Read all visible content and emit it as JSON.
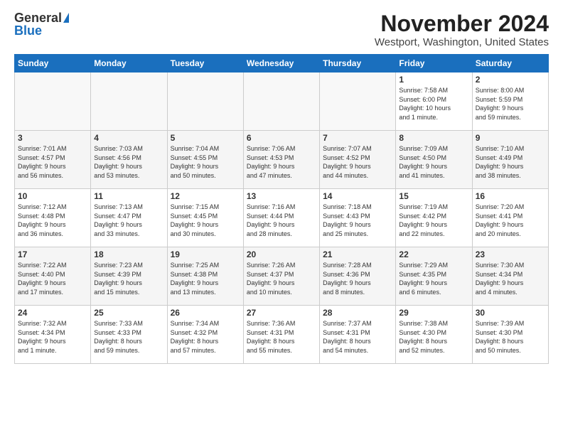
{
  "logo": {
    "general": "General",
    "blue": "Blue"
  },
  "title": "November 2024",
  "location": "Westport, Washington, United States",
  "weekdays": [
    "Sunday",
    "Monday",
    "Tuesday",
    "Wednesday",
    "Thursday",
    "Friday",
    "Saturday"
  ],
  "weeks": [
    [
      {
        "day": "",
        "info": ""
      },
      {
        "day": "",
        "info": ""
      },
      {
        "day": "",
        "info": ""
      },
      {
        "day": "",
        "info": ""
      },
      {
        "day": "",
        "info": ""
      },
      {
        "day": "1",
        "info": "Sunrise: 7:58 AM\nSunset: 6:00 PM\nDaylight: 10 hours\nand 1 minute."
      },
      {
        "day": "2",
        "info": "Sunrise: 8:00 AM\nSunset: 5:59 PM\nDaylight: 9 hours\nand 59 minutes."
      }
    ],
    [
      {
        "day": "3",
        "info": "Sunrise: 7:01 AM\nSunset: 4:57 PM\nDaylight: 9 hours\nand 56 minutes."
      },
      {
        "day": "4",
        "info": "Sunrise: 7:03 AM\nSunset: 4:56 PM\nDaylight: 9 hours\nand 53 minutes."
      },
      {
        "day": "5",
        "info": "Sunrise: 7:04 AM\nSunset: 4:55 PM\nDaylight: 9 hours\nand 50 minutes."
      },
      {
        "day": "6",
        "info": "Sunrise: 7:06 AM\nSunset: 4:53 PM\nDaylight: 9 hours\nand 47 minutes."
      },
      {
        "day": "7",
        "info": "Sunrise: 7:07 AM\nSunset: 4:52 PM\nDaylight: 9 hours\nand 44 minutes."
      },
      {
        "day": "8",
        "info": "Sunrise: 7:09 AM\nSunset: 4:50 PM\nDaylight: 9 hours\nand 41 minutes."
      },
      {
        "day": "9",
        "info": "Sunrise: 7:10 AM\nSunset: 4:49 PM\nDaylight: 9 hours\nand 38 minutes."
      }
    ],
    [
      {
        "day": "10",
        "info": "Sunrise: 7:12 AM\nSunset: 4:48 PM\nDaylight: 9 hours\nand 36 minutes."
      },
      {
        "day": "11",
        "info": "Sunrise: 7:13 AM\nSunset: 4:47 PM\nDaylight: 9 hours\nand 33 minutes."
      },
      {
        "day": "12",
        "info": "Sunrise: 7:15 AM\nSunset: 4:45 PM\nDaylight: 9 hours\nand 30 minutes."
      },
      {
        "day": "13",
        "info": "Sunrise: 7:16 AM\nSunset: 4:44 PM\nDaylight: 9 hours\nand 28 minutes."
      },
      {
        "day": "14",
        "info": "Sunrise: 7:18 AM\nSunset: 4:43 PM\nDaylight: 9 hours\nand 25 minutes."
      },
      {
        "day": "15",
        "info": "Sunrise: 7:19 AM\nSunset: 4:42 PM\nDaylight: 9 hours\nand 22 minutes."
      },
      {
        "day": "16",
        "info": "Sunrise: 7:20 AM\nSunset: 4:41 PM\nDaylight: 9 hours\nand 20 minutes."
      }
    ],
    [
      {
        "day": "17",
        "info": "Sunrise: 7:22 AM\nSunset: 4:40 PM\nDaylight: 9 hours\nand 17 minutes."
      },
      {
        "day": "18",
        "info": "Sunrise: 7:23 AM\nSunset: 4:39 PM\nDaylight: 9 hours\nand 15 minutes."
      },
      {
        "day": "19",
        "info": "Sunrise: 7:25 AM\nSunset: 4:38 PM\nDaylight: 9 hours\nand 13 minutes."
      },
      {
        "day": "20",
        "info": "Sunrise: 7:26 AM\nSunset: 4:37 PM\nDaylight: 9 hours\nand 10 minutes."
      },
      {
        "day": "21",
        "info": "Sunrise: 7:28 AM\nSunset: 4:36 PM\nDaylight: 9 hours\nand 8 minutes."
      },
      {
        "day": "22",
        "info": "Sunrise: 7:29 AM\nSunset: 4:35 PM\nDaylight: 9 hours\nand 6 minutes."
      },
      {
        "day": "23",
        "info": "Sunrise: 7:30 AM\nSunset: 4:34 PM\nDaylight: 9 hours\nand 4 minutes."
      }
    ],
    [
      {
        "day": "24",
        "info": "Sunrise: 7:32 AM\nSunset: 4:34 PM\nDaylight: 9 hours\nand 1 minute."
      },
      {
        "day": "25",
        "info": "Sunrise: 7:33 AM\nSunset: 4:33 PM\nDaylight: 8 hours\nand 59 minutes."
      },
      {
        "day": "26",
        "info": "Sunrise: 7:34 AM\nSunset: 4:32 PM\nDaylight: 8 hours\nand 57 minutes."
      },
      {
        "day": "27",
        "info": "Sunrise: 7:36 AM\nSunset: 4:31 PM\nDaylight: 8 hours\nand 55 minutes."
      },
      {
        "day": "28",
        "info": "Sunrise: 7:37 AM\nSunset: 4:31 PM\nDaylight: 8 hours\nand 54 minutes."
      },
      {
        "day": "29",
        "info": "Sunrise: 7:38 AM\nSunset: 4:30 PM\nDaylight: 8 hours\nand 52 minutes."
      },
      {
        "day": "30",
        "info": "Sunrise: 7:39 AM\nSunset: 4:30 PM\nDaylight: 8 hours\nand 50 minutes."
      }
    ]
  ]
}
